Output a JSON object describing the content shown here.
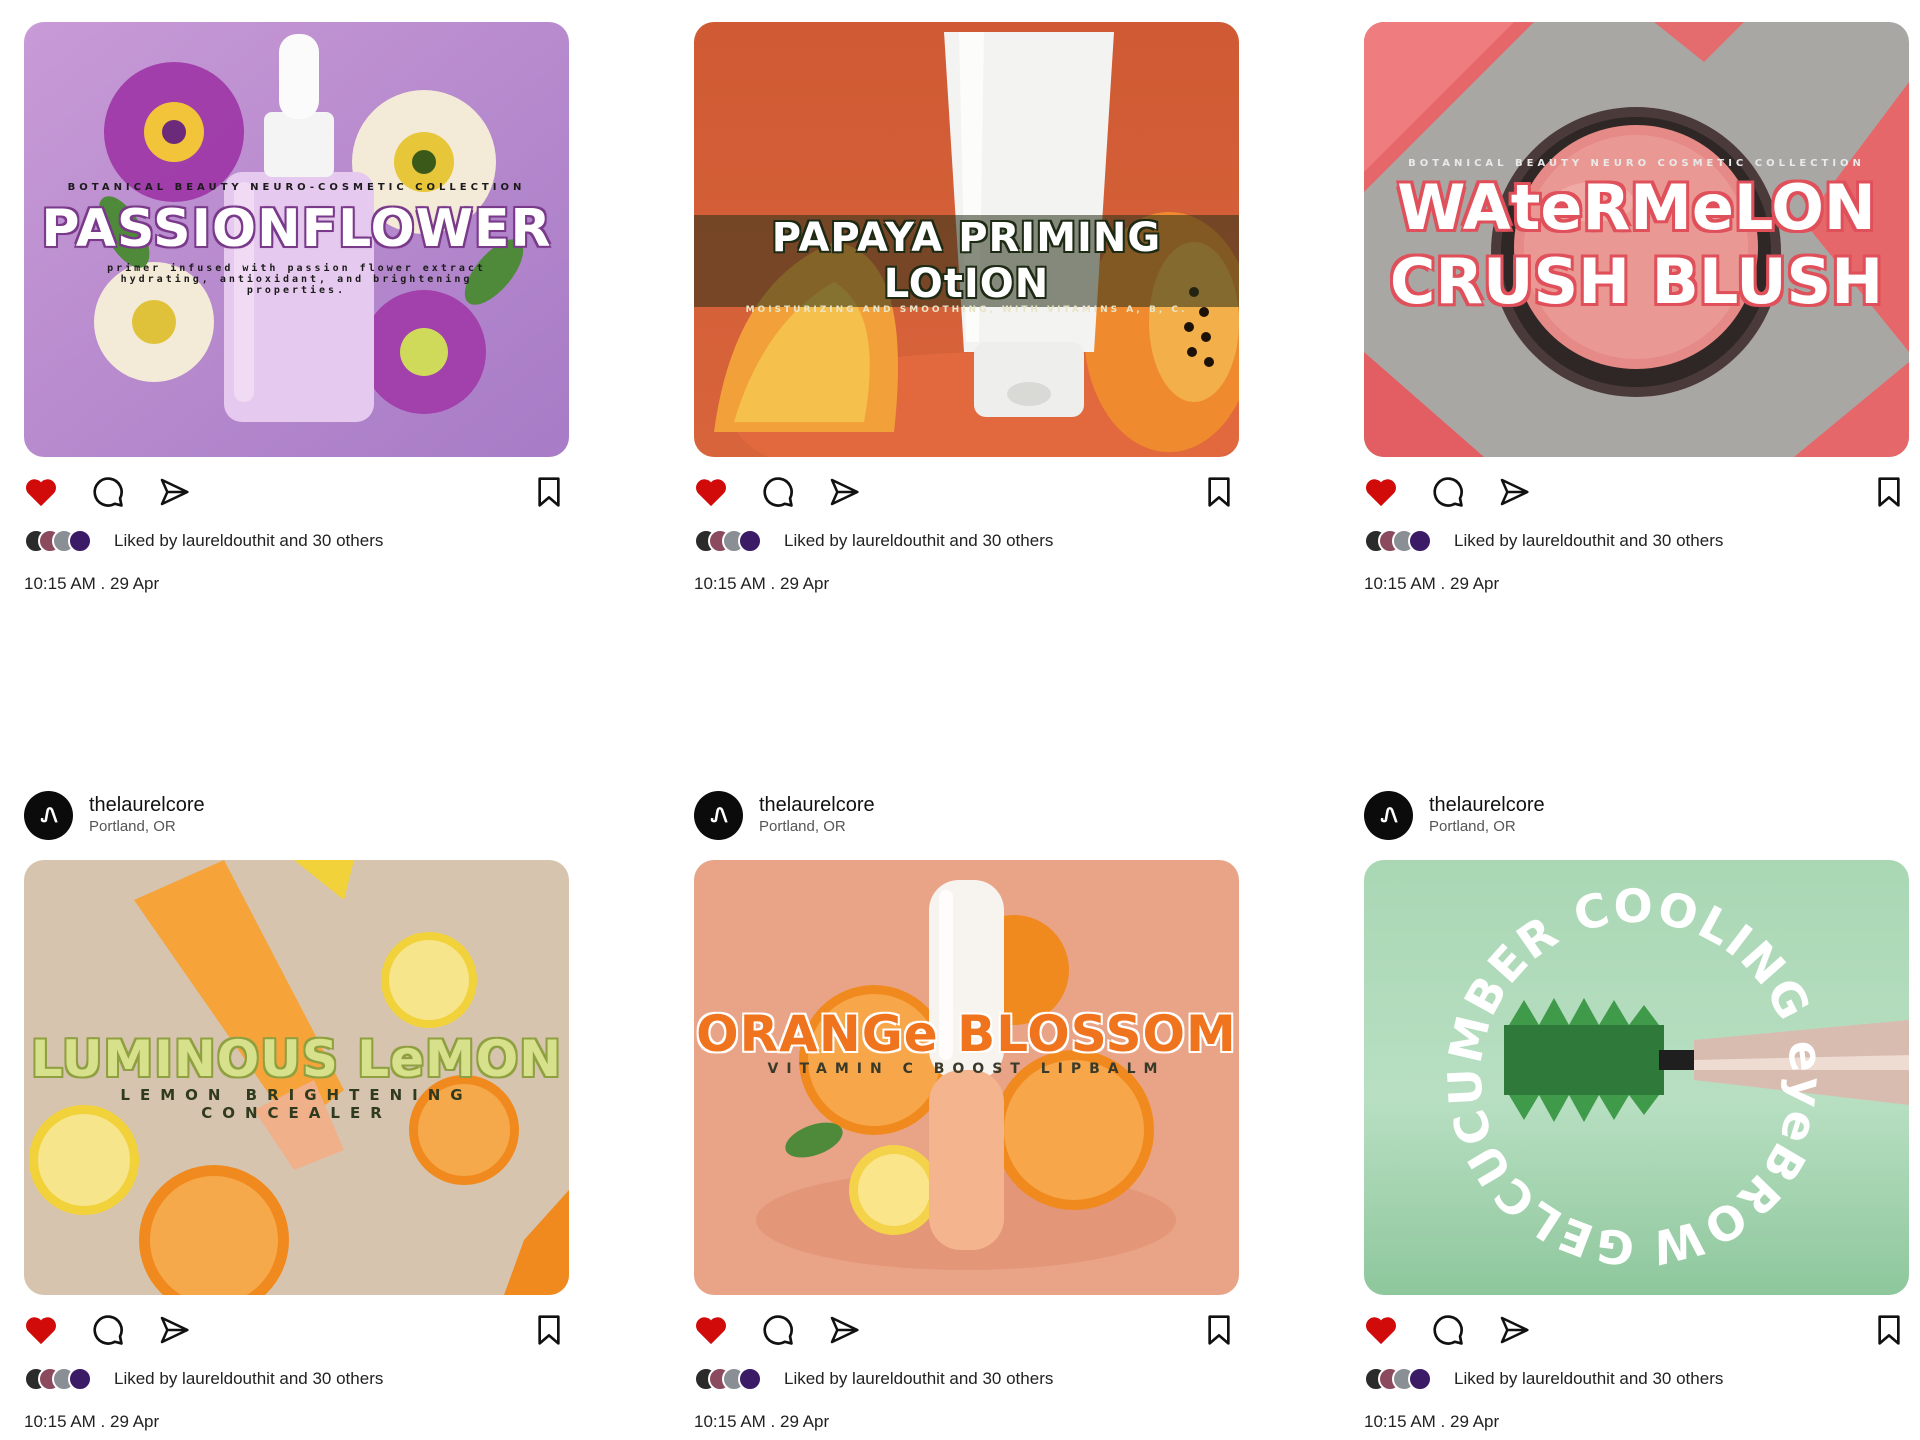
{
  "account": {
    "username": "thelaurelcore",
    "location": "Portland, OR",
    "avatar_monogram": "Ꮑ"
  },
  "likes_text": "Liked by laureldouthit and 30 others",
  "timestamp": "10:15 AM . 29 Apr",
  "icons": {
    "like": "heart-icon",
    "comment": "comment-bubble-icon",
    "share": "paper-plane-icon",
    "save": "bookmark-icon"
  },
  "colors": {
    "like_red": "#d10a0a",
    "text": "#111111",
    "muted": "#555555"
  },
  "posts": [
    {
      "title": "PASSIONFLOWER",
      "eyebrow": "BOTANICAL BEAUTY NEURO-COSMETIC COLLECTION",
      "caption_line1": "primer infused with passion flower extract",
      "caption_line2": "hydrating, antioxidant, and brightening",
      "caption_line3": "properties."
    },
    {
      "title": "PAPAYA PRIMING LOtION",
      "subtitle": "MOISTURIZING AND SMOOTHING, WITH VITAMINS A, B, C."
    },
    {
      "eyebrow": "BOTANICAL BEAUTY NEURO COSMETIC COLLECTION",
      "title_line1": "WAteRMeLON",
      "title_line2": "CRUSH BLUSH"
    },
    {
      "title": "LUMINOUS LeMON",
      "subtitle": "LEMON BRIGHTENING CONCEALER"
    },
    {
      "title": "ORANGe BLOSSOM",
      "subtitle": "VITAMIN C BOOST LIPBALM"
    },
    {
      "ring_text": "GELCUCUMBER COOLING eyeBROW"
    }
  ]
}
